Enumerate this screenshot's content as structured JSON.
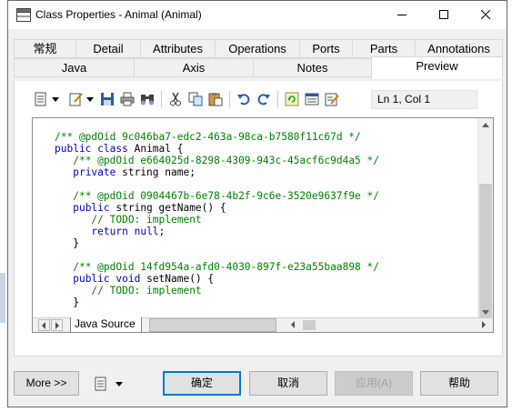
{
  "window": {
    "title": "Class Properties - Animal (Animal)"
  },
  "tabs": {
    "row1": [
      "常规",
      "Detail",
      "Attributes",
      "Operations",
      "Ports",
      "Parts",
      "Annotations"
    ],
    "row2": [
      "Java",
      "Axis",
      "Notes",
      "Preview"
    ],
    "selected": "Preview"
  },
  "toolbar": {
    "icons": [
      "document-menu-icon",
      "edit-menu-icon",
      "save-icon",
      "print-icon",
      "find-icon",
      "cut-icon",
      "copy-icon",
      "paste-icon",
      "undo-icon",
      "redo-icon",
      "refresh-icon",
      "list-icon",
      "edit-properties-icon"
    ],
    "cursor_position": "Ln 1, Col 1"
  },
  "editor": {
    "lines": [
      "/** @pdOid 9c046ba7-edc2-463a-98ca-b7580f11c67d */",
      "public class Animal {",
      "   /** @pdOid e664025d-8298-4309-943c-45acf6c9d4a5 */",
      "   private string name;",
      "",
      "   /** @pdOid 0904467b-6e78-4b2f-9c6e-3520e9637f9e */",
      "   public string getName() {",
      "      // TODO: implement",
      "      return null;",
      "   }",
      "",
      "   /** @pdOid 14fd954a-afd0-4030-897f-e23a55baa898 */",
      "   public void setName() {",
      "      // TODO: implement",
      "   }",
      "",
      "}"
    ],
    "source_tab": "Java Source"
  },
  "buttons": {
    "more": "More >>",
    "ok": "确定",
    "cancel": "取消",
    "apply": "应用(A)",
    "help": "帮助"
  },
  "colors": {
    "comment": "#008000",
    "keyword": "#0000c8",
    "default_button_border": "#0078d7"
  }
}
